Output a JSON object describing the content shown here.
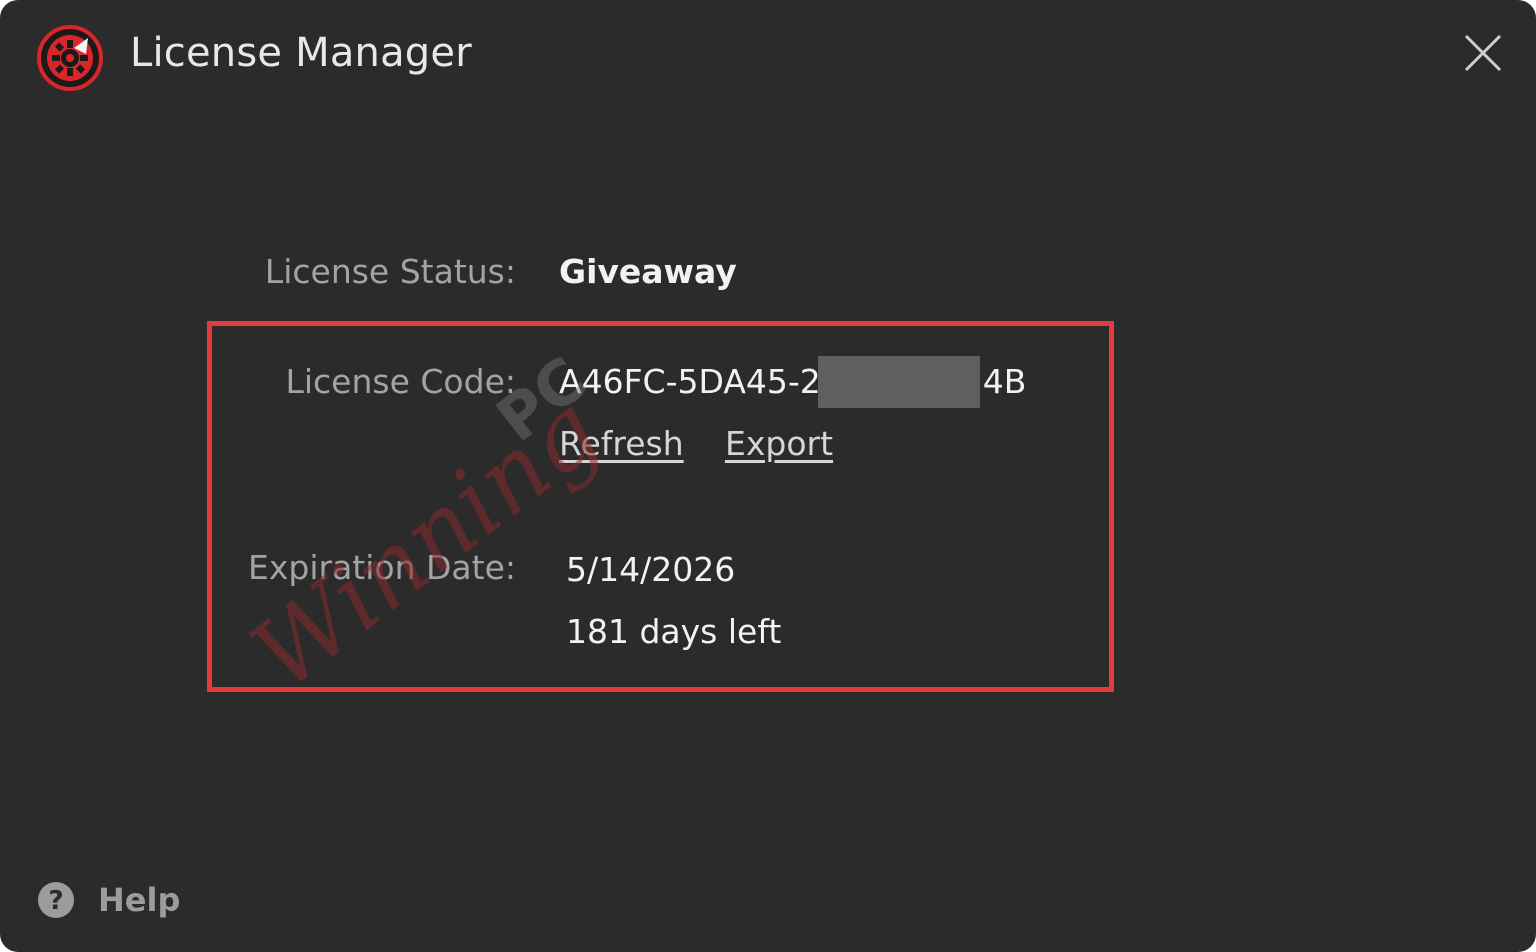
{
  "window": {
    "title": "License Manager",
    "accent_color": "#e8393d",
    "background_color": "#2b2b2b"
  },
  "icons": {
    "app": "app-logo-icon",
    "close": "close-icon",
    "help": "question-circle-icon"
  },
  "license": {
    "status_label": "License Status:",
    "status_value": "Giveaway",
    "code_label": "License Code:",
    "code_visible_prefix": "A46FC-5DA45-2",
    "code_visible_suffix": "4B",
    "code_masked": true,
    "refresh_label": "Refresh",
    "export_label": "Export",
    "expiration_label": "Expiration Date:",
    "expiration_date": "5/14/2026",
    "days_left": "181 days left"
  },
  "watermark": {
    "text_main": "Winning",
    "text_small": "PC"
  },
  "footer": {
    "help_label": "Help"
  }
}
